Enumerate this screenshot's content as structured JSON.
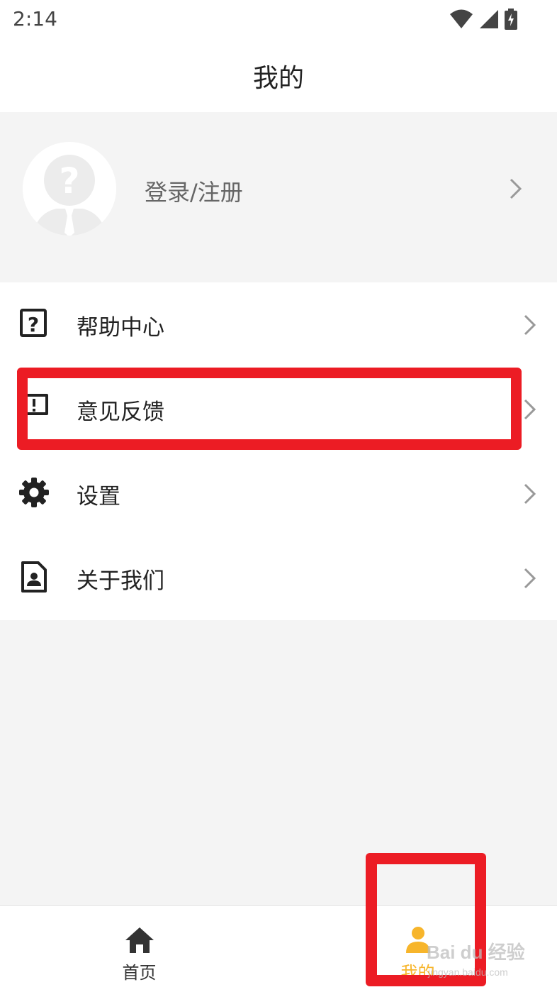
{
  "status_bar": {
    "time": "2:14",
    "icons": [
      "wifi-icon",
      "cell-signal-icon",
      "battery-charging-icon"
    ]
  },
  "header": {
    "title": "我的"
  },
  "profile": {
    "avatar_icon": "avatar-placeholder-icon",
    "login_label": "登录/注册"
  },
  "menu": {
    "items": [
      {
        "label": "帮助中心",
        "icon": "help-icon"
      },
      {
        "label": "意见反馈",
        "icon": "feedback-icon"
      },
      {
        "label": "设置",
        "icon": "gear-icon"
      },
      {
        "label": "关于我们",
        "icon": "about-icon"
      }
    ]
  },
  "tabbar": {
    "tabs": [
      {
        "label": "首页",
        "icon": "home-icon",
        "active": false
      },
      {
        "label": "我的",
        "icon": "person-icon",
        "active": true
      }
    ]
  },
  "colors": {
    "accent": "#f7b52b",
    "highlight": "#ec1c24",
    "text": "#222222",
    "background": "#f4f4f4"
  },
  "watermark": {
    "brand": "Bai du 经验",
    "url": "jingyan.baidu.com"
  }
}
